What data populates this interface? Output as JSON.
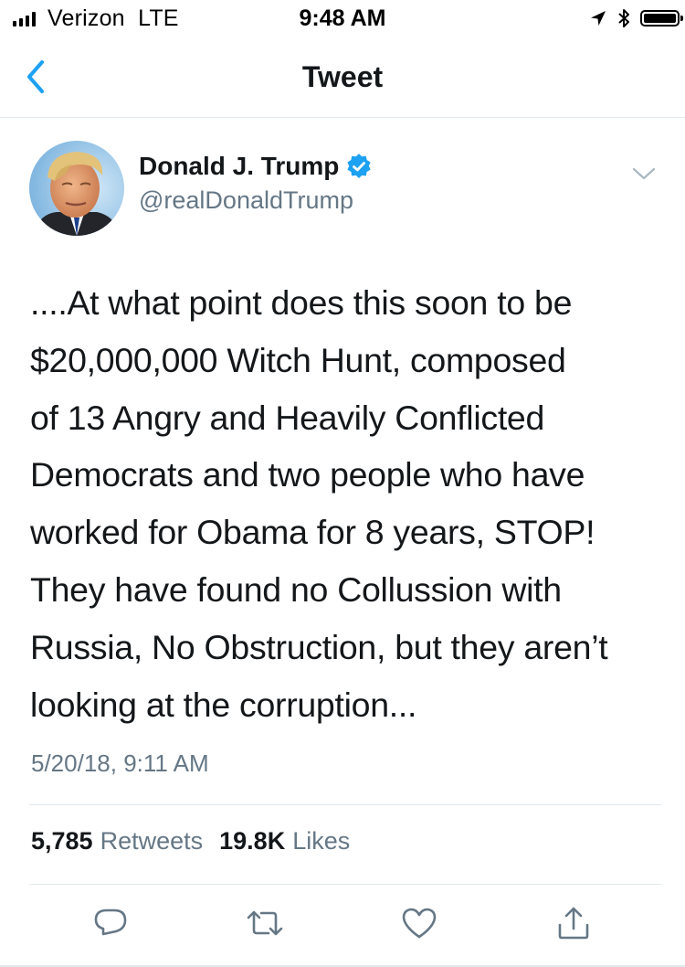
{
  "status_bar": {
    "carrier": "Verizon  LTE",
    "time": "9:48 AM",
    "icons": [
      "signal-icon",
      "location-arrow-icon",
      "bluetooth-icon",
      "battery-icon"
    ]
  },
  "nav": {
    "title": "Tweet",
    "back_icon": "chevron-left-icon"
  },
  "tweet": {
    "author_name": "Donald J. Trump",
    "handle": "@realDonaldTrump",
    "verified_icon": "verified-badge-icon",
    "menu_icon": "chevron-down-icon",
    "text_lines": [
      "....At what point does this soon to be",
      "$20,000,000 Witch Hunt, composed",
      "of 13 Angry and Heavily Conflicted",
      "Democrats and two people who have",
      "worked for Obama for 8 years, STOP!",
      "They have found no Collussion with",
      "Russia, No Obstruction, but they aren’t",
      "looking at the corruption..."
    ],
    "timestamp": "5/20/18, 9:11 AM",
    "retweet_count": "5,785",
    "retweet_label": "Retweets",
    "like_count": "19.8K",
    "like_label": "Likes"
  },
  "actions": [
    "reply-icon",
    "retweet-icon",
    "like-icon",
    "share-icon"
  ],
  "colors": {
    "accent": "#1da1f2",
    "text": "#14171a",
    "secondary": "#657786",
    "divider": "#e1e8ed",
    "icon": "#657786"
  }
}
